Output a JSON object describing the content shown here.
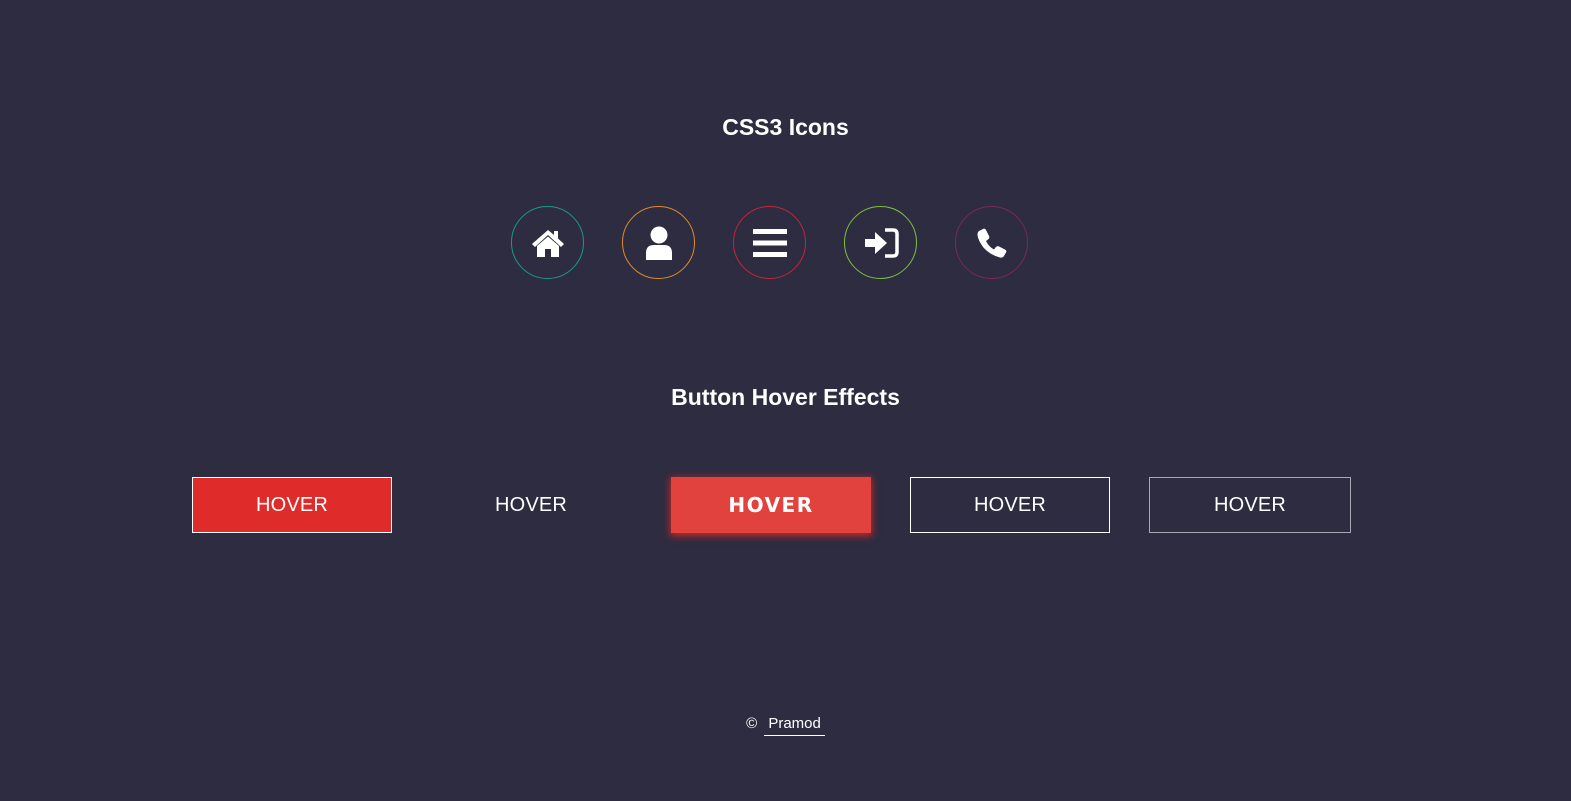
{
  "sections": {
    "icons_title": "CSS3 Icons",
    "buttons_title": "Button Hover Effects"
  },
  "icons": [
    {
      "name": "home-icon",
      "border_color": "#1a9a8a"
    },
    {
      "name": "user-icon",
      "border_color": "#e08a2c"
    },
    {
      "name": "menu-icon",
      "border_color": "#c4253c"
    },
    {
      "name": "sign-in-icon",
      "border_color": "#7fbf3f"
    },
    {
      "name": "phone-icon",
      "border_color": "#7a2a55"
    }
  ],
  "buttons": [
    {
      "label": "HOVER"
    },
    {
      "label": "HOVER"
    },
    {
      "label": "HOVER"
    },
    {
      "label": "HOVER"
    },
    {
      "label": "HOVER"
    }
  ],
  "colors": {
    "background": "#2e2c40",
    "accent_red": "#df2b2a"
  },
  "footer": {
    "copyright_symbol": "©",
    "author": "Pramod"
  }
}
